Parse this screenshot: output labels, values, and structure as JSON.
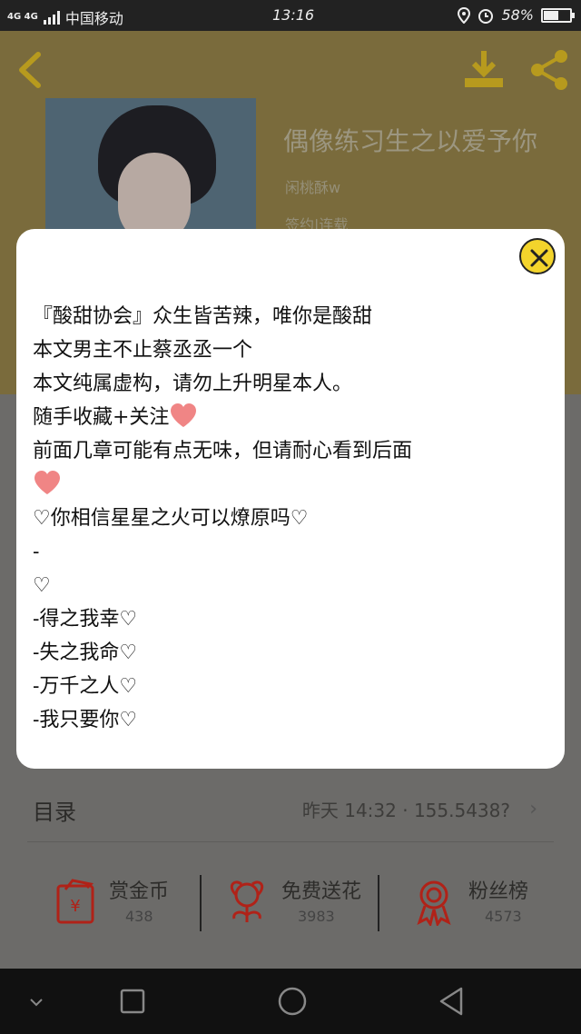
{
  "status_bar": {
    "network": "4G 4G",
    "carrier": "中国移动",
    "time": "13:16",
    "battery": "58%",
    "battery_level": 0.58
  },
  "header": {
    "book_title": "偶像练习生之以爱予你",
    "author": "闲桃酥w",
    "status": "签约|连载"
  },
  "modal": {
    "lines": [
      "『酸甜协会』众生皆苦辣，唯你是酸甜",
      "本文男主不止蔡丞丞一个",
      "本文纯属虚构，请勿上升明星本人。",
      "随手收藏+关注",
      "前面几章可能有点无味，但请耐心看到后面",
      "",
      "♡你相信星星之火可以燎原吗♡",
      "-",
      "♡",
      "-得之我幸♡",
      "-失之我命♡",
      "-万千之人♡",
      "-我只要你♡"
    ]
  },
  "toc": {
    "label": "目录",
    "update_info": "昨天 14:32 · 155.5438?"
  },
  "stats": [
    {
      "label": "赏金币",
      "count": "438"
    },
    {
      "label": "免费送花",
      "count": "3983"
    },
    {
      "label": "粉丝榜",
      "count": "4573"
    }
  ],
  "colors": {
    "accent": "#f3d42c",
    "heart": "#f08585",
    "stat_icon": "#b02218"
  }
}
